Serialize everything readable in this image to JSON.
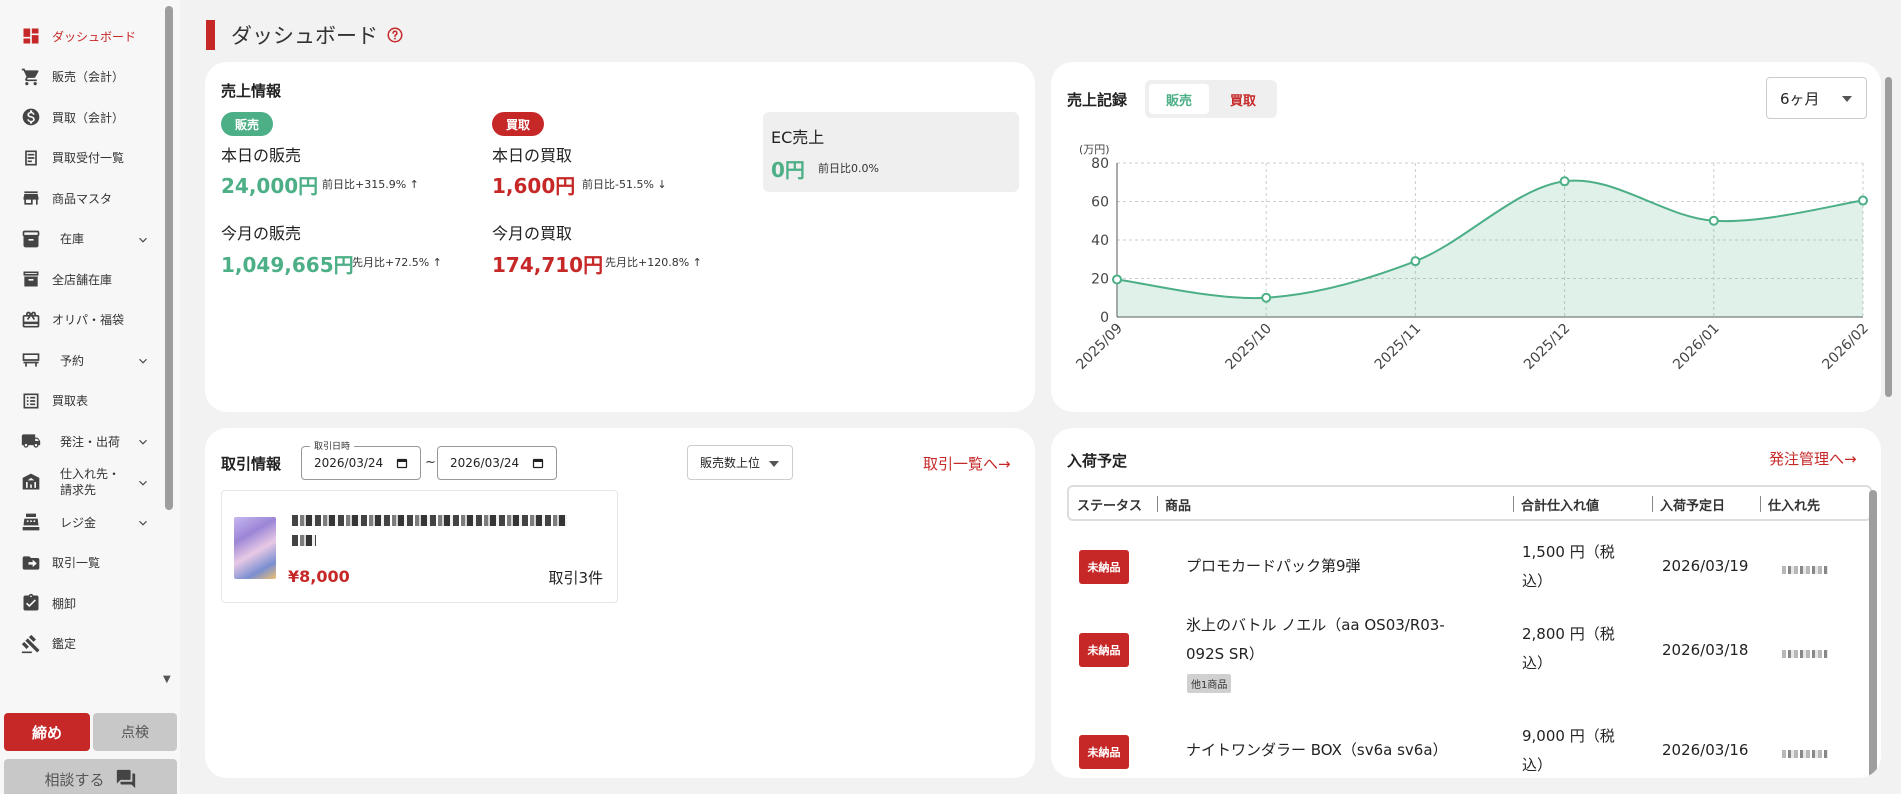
{
  "sidebar": {
    "items": [
      {
        "label": "ダッシュボード",
        "icon": "dashboard-icon"
      },
      {
        "label": "販売（会計）",
        "icon": "cart-icon"
      },
      {
        "label": "買取（会計）",
        "icon": "dollar-icon"
      },
      {
        "label": "買取受付一覧",
        "icon": "receipt-icon"
      },
      {
        "label": "商品マスタ",
        "icon": "store-icon"
      },
      {
        "label": "在庫",
        "icon": "inventory-icon"
      },
      {
        "label": "全店舗在庫",
        "icon": "archive-icon"
      },
      {
        "label": "オリパ・福袋",
        "icon": "gift-icon"
      },
      {
        "label": "予約",
        "icon": "reserve-icon"
      },
      {
        "label": "買取表",
        "icon": "list-icon"
      },
      {
        "label": "発注・出荷",
        "icon": "truck-icon"
      },
      {
        "label": "仕入れ先・請求先",
        "icon": "warehouse-icon"
      },
      {
        "label": "レジ金",
        "icon": "register-icon"
      },
      {
        "label": "取引一覧",
        "icon": "transactions-icon"
      },
      {
        "label": "棚卸",
        "icon": "clipboard-check-icon"
      },
      {
        "label": "鑑定",
        "icon": "gavel-icon"
      }
    ],
    "close_label": "締め",
    "check_label": "点検",
    "consult_label": "相談する"
  },
  "page": {
    "title": "ダッシュボード"
  },
  "sales_info": {
    "title": "売上情報",
    "sales_badge": "販売",
    "purchase_badge": "買取",
    "today_sales_label": "本日の販売",
    "today_sales_value": "24,000円",
    "today_sales_cmp": "前日比+315.9% ↑",
    "today_purchase_label": "本日の買取",
    "today_purchase_value": "1,600円",
    "today_purchase_cmp": "前日比-51.5% ↓",
    "month_sales_label": "今月の販売",
    "month_sales_value": "1,049,665円",
    "month_sales_cmp": "先月比+72.5% ↑",
    "month_purchase_label": "今月の買取",
    "month_purchase_value": "174,710円",
    "month_purchase_cmp": "先月比+120.8% ↑",
    "ec_label": "EC売上",
    "ec_value": "0円",
    "ec_cmp": "前日比0.0%"
  },
  "sales_record": {
    "title": "売上記録",
    "tab_sales": "販売",
    "tab_purchase": "買取",
    "period": "6ヶ月"
  },
  "chart_data": {
    "type": "area",
    "x": [
      "2025/09",
      "2025/10",
      "2025/11",
      "2025/12",
      "2026/01",
      "2026/02"
    ],
    "series": [
      {
        "values": [
          19.5,
          10,
          29,
          70.5,
          50,
          60.5
        ]
      }
    ],
    "ylabel": "(万円)",
    "ylim": [
      0,
      80
    ],
    "yticks": [
      0,
      20,
      40,
      60,
      80
    ],
    "grid": true,
    "color": "#4caf86"
  },
  "transactions": {
    "title": "取引情報",
    "date_legend": "取引日時",
    "date_from": "2026/03/24",
    "date_to": "2026/03/24",
    "tilde": "~",
    "sort": "販売数上位",
    "link": "取引一覧へ→",
    "item_price": "¥8,000",
    "item_count": "取引3件"
  },
  "arrivals": {
    "title": "入荷予定",
    "link": "発注管理へ→",
    "columns": [
      "ステータス",
      "商品",
      "合計仕入れ値",
      "入荷予定日",
      "仕入れ先"
    ],
    "rows": [
      {
        "status": "未納品",
        "product": "プロモカードパック第9弾",
        "extra": "",
        "price1": "1,500 円（税",
        "price2": "込）",
        "date": "2026/03/19"
      },
      {
        "status": "未納品",
        "product": "氷上のバトル ノエル（aa OS03/R03-",
        "product2": "092S SR）",
        "extra": "他1商品",
        "price1": "2,800 円（税",
        "price2": "込）",
        "date": "2026/03/18"
      },
      {
        "status": "未納品",
        "product": "ナイトワンダラー BOX（sv6a sv6a）",
        "extra": "",
        "price1": "9,000 円（税",
        "price2": "込）",
        "date": "2026/03/16"
      }
    ]
  }
}
